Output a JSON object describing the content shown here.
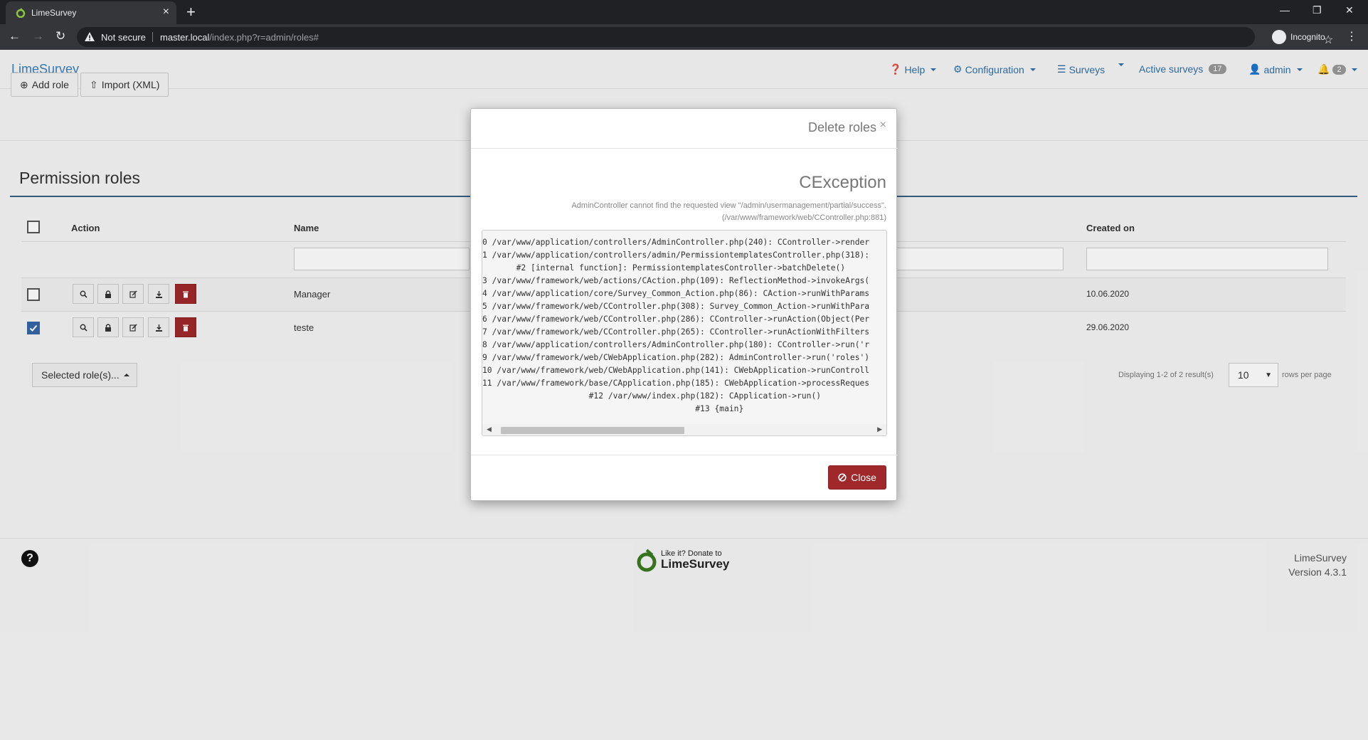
{
  "browser": {
    "tab_title": "LimeSurvey",
    "not_secure": "Not secure",
    "url_host": "master.local",
    "url_path": "/index.php?r=admin/roles#",
    "incognito": "Incognito"
  },
  "nav": {
    "brand": "LimeSurvey",
    "help": "Help",
    "configuration": "Configuration",
    "surveys": "Surveys",
    "active_surveys": "Active surveys",
    "active_surveys_count": "17",
    "user": "admin",
    "notifications_count": "2"
  },
  "toolbar": {
    "add_role": "Add role",
    "import_xml": "Import (XML)"
  },
  "page_title": "Permission roles",
  "table": {
    "headers": {
      "action": "Action",
      "name": "Name",
      "created_on": "Created on"
    },
    "rows": [
      {
        "name": "Manager",
        "created_on": "10.06.2020",
        "checked": false
      },
      {
        "name": "teste",
        "created_on": "29.06.2020",
        "checked": true
      }
    ]
  },
  "selected_roles_button": "Selected role(s)...",
  "pager": {
    "summary": "Displaying 1-2 of 2 result(s)",
    "page_size": "10",
    "rows_per_page": "rows per page"
  },
  "footer": {
    "donate_line1": "Like it? Donate to",
    "donate_line2": "LimeSurvey",
    "app_name": "LimeSurvey",
    "version": "Version 4.3.1"
  },
  "modal": {
    "title": "Delete roles",
    "exception_title": "CException",
    "exception_message_1": "AdminController cannot find the requested view \"/admin/usermanagement/partial/success\".",
    "exception_message_2": "(/var/www/framework/web/CController.php:881)",
    "trace": [
      "0 /var/www/application/controllers/AdminController.php(240): CController->render",
      "1 /var/www/application/controllers/admin/PermissiontemplatesController.php(318):",
      "       #2 [internal function]: PermissiontemplatesController->batchDelete()",
      "3 /var/www/framework/web/actions/CAction.php(109): ReflectionMethod->invokeArgs(",
      "4 /var/www/application/core/Survey_Common_Action.php(86): CAction->runWithParams",
      "5 /var/www/framework/web/CController.php(308): Survey_Common_Action->runWithPara",
      "6 /var/www/framework/web/CController.php(286): CController->runAction(Object(Per",
      "7 /var/www/framework/web/CController.php(265): CController->runActionWithFilters",
      "8 /var/www/application/controllers/AdminController.php(180): CController->run('r",
      "9 /var/www/framework/web/CWebApplication.php(282): AdminController->run('roles')",
      "10 /var/www/framework/web/CWebApplication.php(141): CWebApplication->runControll",
      "11 /var/www/framework/base/CApplication.php(185): CWebApplication->processReques",
      "                      #12 /var/www/index.php(182): CApplication->run()",
      "                                            #13 {main}"
    ],
    "close": "Close"
  },
  "colors": {
    "brand_blue": "#3a7fbf",
    "danger_red": "#a0282a",
    "checkbox_blue": "#3566a6"
  },
  "icons": [
    "search-icon",
    "lock-icon",
    "edit-icon",
    "download-icon",
    "trash-icon",
    "plus-circle-icon",
    "upload-icon",
    "ban-icon",
    "bell-icon",
    "user-icon",
    "gears-icon",
    "list-icon",
    "question-circle-icon"
  ]
}
